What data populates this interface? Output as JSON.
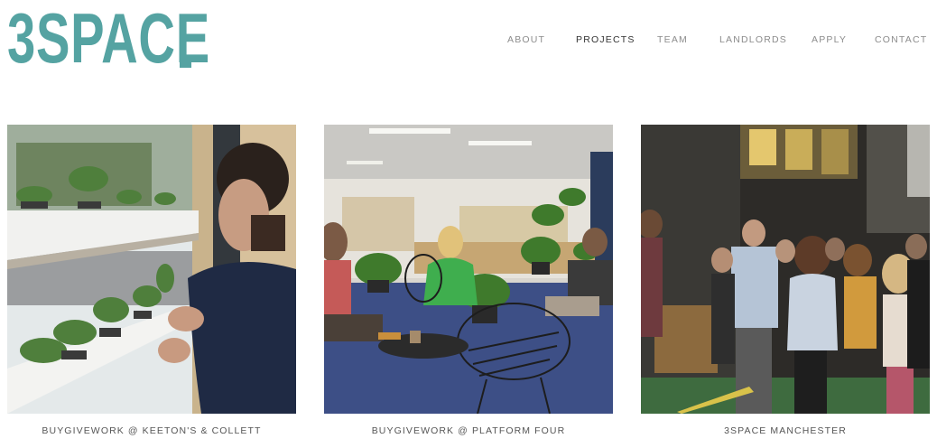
{
  "header": {
    "logo_text": "3SPACE",
    "nav": [
      {
        "label": "ABOUT",
        "active": false
      },
      {
        "label": "PROJECTS",
        "active": true
      },
      {
        "label": "TEAM",
        "active": false
      },
      {
        "label": "LANDLORDS",
        "active": false
      },
      {
        "label": "APPLY",
        "active": false
      },
      {
        "label": "CONTACT",
        "active": false
      }
    ]
  },
  "projects": [
    {
      "caption": "BUYGIVEWORK @ KEETON'S & COLLETT",
      "image": "man-tending-plants-window-photo"
    },
    {
      "caption": "BUYGIVEWORK @ PLATFORM FOUR",
      "image": "coworking-office-plants-photo"
    },
    {
      "caption": "3SPACE MANCHESTER",
      "image": "crowd-event-dark-hall-photo"
    }
  ],
  "colors": {
    "brand": "#55a3a2",
    "nav_inactive": "#8c8c8c",
    "nav_active": "#333333",
    "caption": "#555555"
  }
}
